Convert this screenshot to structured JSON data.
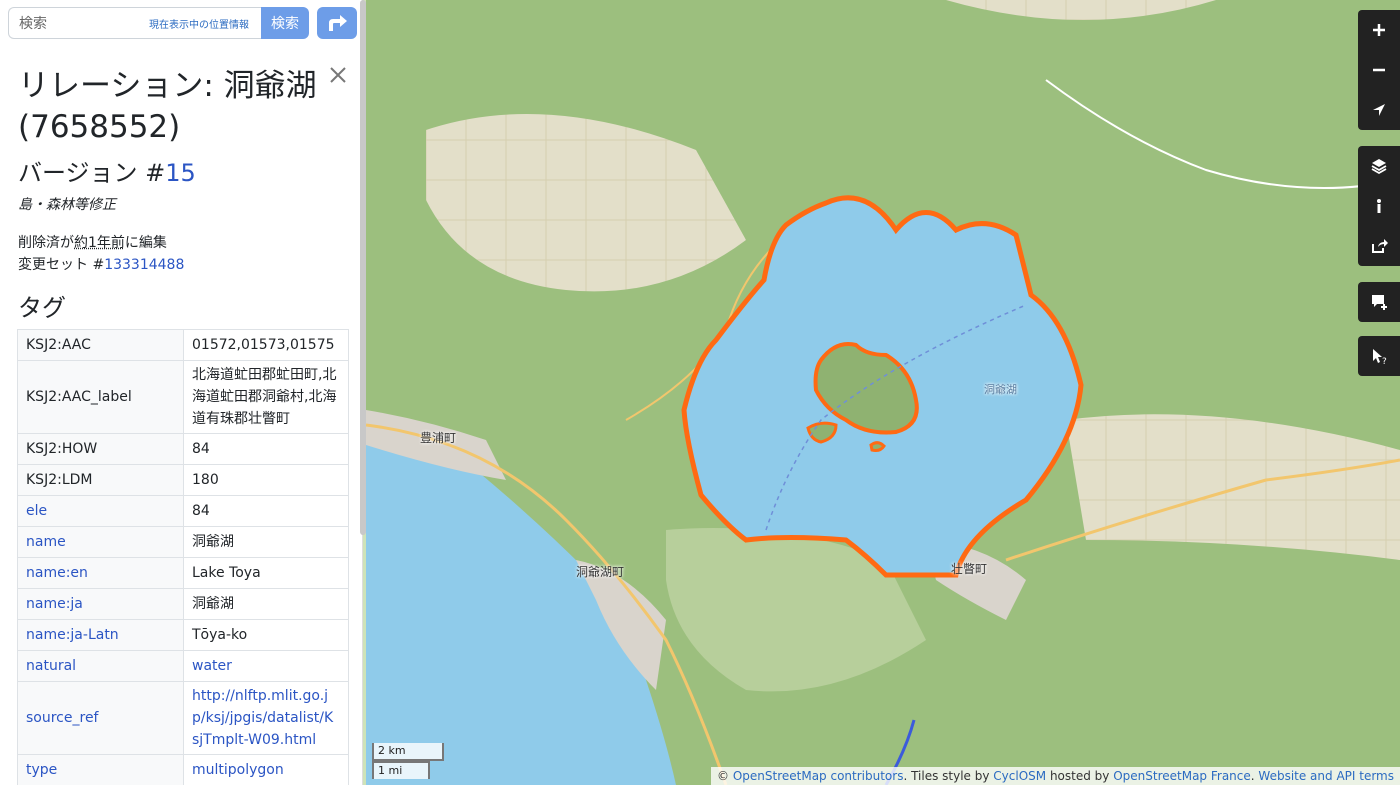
{
  "search": {
    "placeholder": "検索",
    "where_am_i": "現在表示中の位置情報",
    "button": "検索"
  },
  "feature": {
    "title": "リレーション: 洞爺湖 (7658552)",
    "version_prefix": "バージョン #",
    "version_number": "15",
    "comment": "島・森林等修正",
    "deleted_text_pre": "削除済が",
    "deleted_time": "約1年前",
    "deleted_text_post": "に編集",
    "changeset_prefix": "変更セット #",
    "changeset_id": "133314488",
    "tags_heading": "タグ"
  },
  "tags": [
    {
      "key": "KSJ2:AAC",
      "value": "01572,01573,01575",
      "key_link": false,
      "value_link": false
    },
    {
      "key": "KSJ2:AAC_label",
      "value": "北海道虻田郡虻田町,北海道虻田郡洞爺村,北海道有珠郡壮瞥町",
      "key_link": false,
      "value_link": false
    },
    {
      "key": "KSJ2:HOW",
      "value": "84",
      "key_link": false,
      "value_link": false
    },
    {
      "key": "KSJ2:LDM",
      "value": "180",
      "key_link": false,
      "value_link": false
    },
    {
      "key": "ele",
      "value": "84",
      "key_link": true,
      "value_link": false
    },
    {
      "key": "name",
      "value": "洞爺湖",
      "key_link": true,
      "value_link": false
    },
    {
      "key": "name:en",
      "value": "Lake Toya",
      "key_link": true,
      "value_link": false
    },
    {
      "key": "name:ja",
      "value": "洞爺湖",
      "key_link": true,
      "value_link": false
    },
    {
      "key": "name:ja-Latn",
      "value": "Tōya-ko",
      "key_link": true,
      "value_link": false
    },
    {
      "key": "natural",
      "value": "water",
      "key_link": true,
      "value_link": true
    },
    {
      "key": "source_ref",
      "value": "http://nlftp.mlit.go.jp/ksj/jpgis/datalist/KsjTmplt-W09.html",
      "key_link": true,
      "value_link": true
    },
    {
      "key": "type",
      "value": "multipolygon",
      "key_link": true,
      "value_link": true
    }
  ],
  "map": {
    "labels": {
      "toyoura": "豊浦町",
      "toyako_town": "洞爺湖町",
      "sobetsu": "壮瞥町",
      "lake": "洞爺湖"
    },
    "scale_metric": "2 km",
    "scale_imperial": "1 mi",
    "attribution": {
      "copyright": "© ",
      "osm": "OpenStreetMap contributors",
      "tiles_style": ". Tiles style by ",
      "cyclosm": "CyclOSM",
      "hosted_by": " hosted by ",
      "osm_france": "OpenStreetMap France",
      "sep": ". ",
      "terms": "Website and API terms"
    },
    "colors": {
      "water": "#8fcbea",
      "outline": "#ff6a13",
      "forest": "#8fb271"
    }
  },
  "controls": {
    "zoom_in_icon": "plus-icon",
    "zoom_out_icon": "minus-icon",
    "locate_icon": "location-arrow-icon",
    "layers_icon": "layers-icon",
    "info_icon": "info-icon",
    "share_icon": "share-icon",
    "note_icon": "add-note-icon",
    "query_icon": "query-features-icon"
  }
}
